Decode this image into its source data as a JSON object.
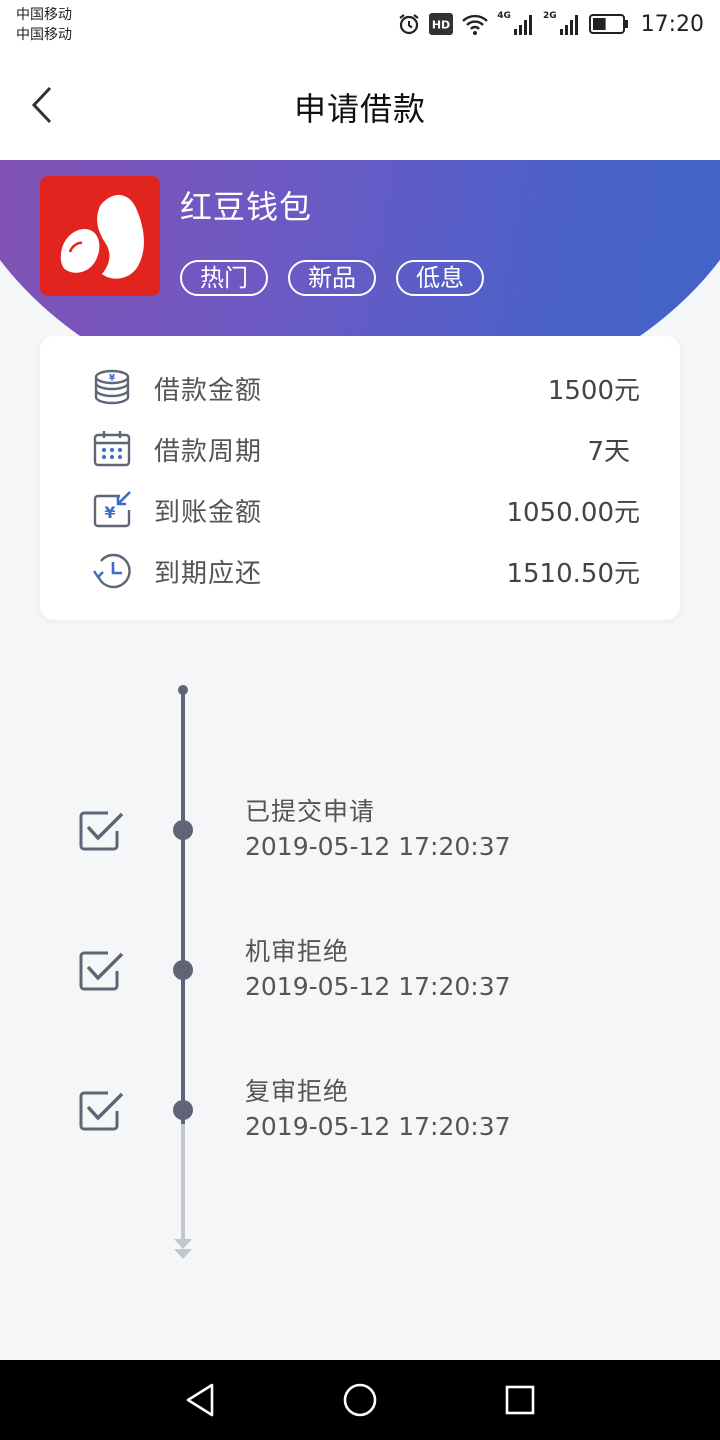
{
  "status_bar": {
    "carrier_1": "中国移动",
    "carrier_2": "中国移动",
    "hd_badge": "HD",
    "network_1": "4G",
    "network_2": "2G",
    "time": "17:20",
    "battery_fraction": 0.45,
    "icons": [
      "alarm-icon",
      "hd-icon",
      "wifi-icon",
      "signal-icon",
      "battery-icon"
    ]
  },
  "nav": {
    "title": "申请借款",
    "back_icon": "chevron-left-icon"
  },
  "product": {
    "name": "红豆钱包",
    "tags": [
      "热门",
      "新品",
      "低息"
    ],
    "logo_color": "#e1241e"
  },
  "loan_info": [
    {
      "icon": "coins-icon",
      "label": "借款金额",
      "value": "1500元"
    },
    {
      "icon": "calendar-icon",
      "label": "借款周期",
      "value": "7天"
    },
    {
      "icon": "receive-money-icon",
      "label": "到账金额",
      "value": "1050.00元"
    },
    {
      "icon": "history-clock-icon",
      "label": "到期应还",
      "value": "1510.50元"
    }
  ],
  "timeline": [
    {
      "title": "已提交申请",
      "time": "2019-05-12 17:20:37",
      "checked": true
    },
    {
      "title": "机审拒绝",
      "time": "2019-05-12 17:20:37",
      "checked": true
    },
    {
      "title": "复审拒绝",
      "time": "2019-05-12 17:20:37",
      "checked": true
    }
  ],
  "colors": {
    "gradient_start": "#8a4fad",
    "gradient_end": "#3e64c8",
    "icon_blue": "#3e6bc7",
    "timeline": "#5f6577",
    "background": "#f5f6f7"
  },
  "android_nav": [
    "back-triangle-icon",
    "home-circle-icon",
    "recents-square-icon"
  ]
}
